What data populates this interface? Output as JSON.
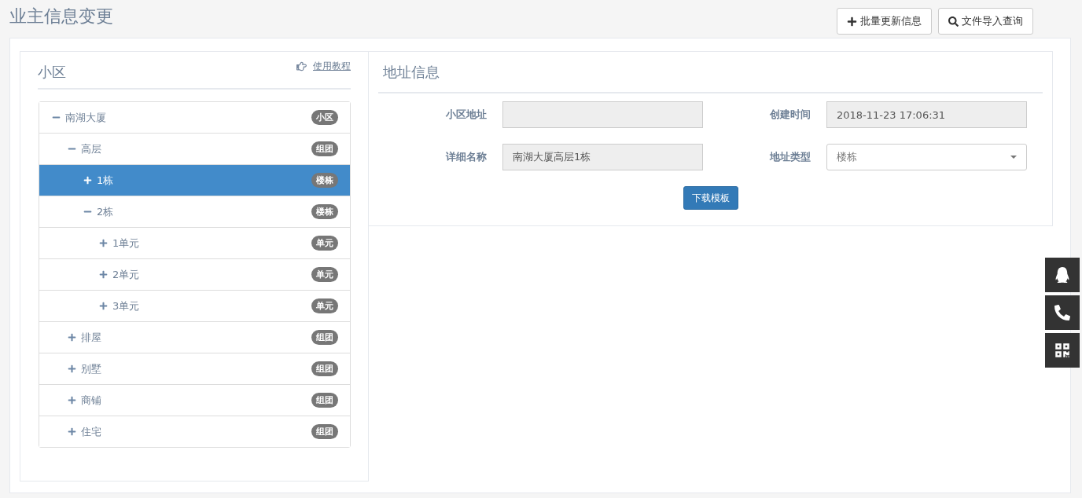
{
  "page": {
    "title": "业主信息变更"
  },
  "toolbar": [
    {
      "kind": "add",
      "label": "批量更新信息"
    },
    {
      "kind": "search",
      "label": "文件导入查询"
    }
  ],
  "tree_panel": {
    "title": "小区",
    "help_link": "使用教程",
    "items": [
      {
        "label": "南湖大厦",
        "badge": "小区",
        "expanded": true,
        "selected": false,
        "children": [
          {
            "label": "高层",
            "badge": "组团",
            "expanded": true,
            "selected": false,
            "children": [
              {
                "label": "1栋",
                "badge": "楼栋",
                "expanded": false,
                "selected": true
              },
              {
                "label": "2栋",
                "badge": "楼栋",
                "expanded": true,
                "selected": false,
                "children": [
                  {
                    "label": "1单元",
                    "badge": "单元",
                    "expanded": false,
                    "selected": false
                  },
                  {
                    "label": "2单元",
                    "badge": "单元",
                    "expanded": false,
                    "selected": false
                  },
                  {
                    "label": "3单元",
                    "badge": "单元",
                    "expanded": false,
                    "selected": false
                  }
                ]
              }
            ]
          },
          {
            "label": "排屋",
            "badge": "组团",
            "expanded": false,
            "selected": false
          },
          {
            "label": "别墅",
            "badge": "组团",
            "expanded": false,
            "selected": false
          },
          {
            "label": "商铺",
            "badge": "组团",
            "expanded": false,
            "selected": false
          },
          {
            "label": "住宅",
            "badge": "组团",
            "expanded": false,
            "selected": false
          }
        ]
      }
    ]
  },
  "address_panel": {
    "title": "地址信息",
    "fields": [
      {
        "kind": "text",
        "label": "小区地址"
      },
      {
        "kind": "text",
        "label": "创建时间",
        "value": "2018-11-23 17:06:31"
      },
      {
        "kind": "text",
        "label": "详细名称",
        "value": "南湖大厦高层1栋"
      },
      {
        "kind": "select",
        "label": "地址类型",
        "value": "楼栋"
      }
    ],
    "button": "下载模板"
  },
  "side_buttons": [
    {
      "kind": "chat"
    },
    {
      "kind": "phone"
    },
    {
      "kind": "qr"
    }
  ]
}
